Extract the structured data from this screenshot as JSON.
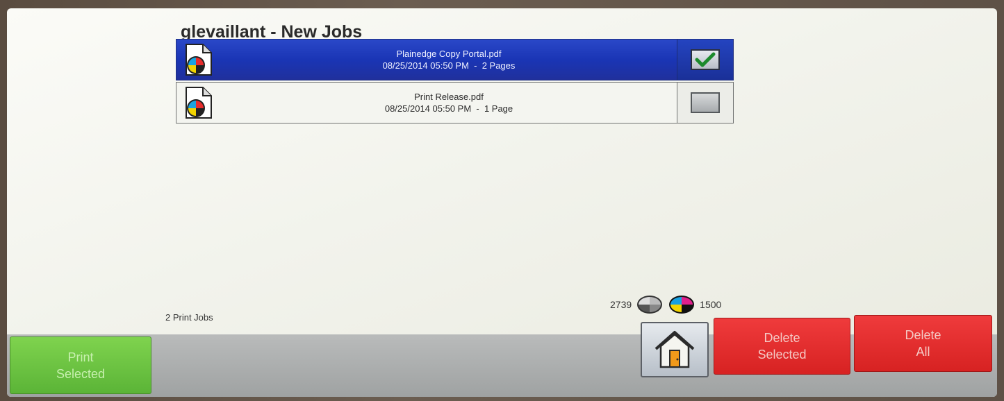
{
  "header": {
    "title": "glevaillant - New Jobs"
  },
  "jobs": [
    {
      "name": "Plainedge Copy Portal.pdf",
      "details": "08/25/2014 05:50 PM  -  2 Pages",
      "selected": true
    },
    {
      "name": "Print Release.pdf",
      "details": "08/25/2014 05:50 PM  -  1 Page",
      "selected": false
    }
  ],
  "status": {
    "job_count": "2 Print Jobs",
    "black_toner": "2739",
    "color_toner": "1500"
  },
  "buttons": {
    "print_selected_line1": "Print",
    "print_selected_line2": "Selected",
    "delete_selected_line1": "Delete",
    "delete_selected_line2": "Selected",
    "delete_all_line1": "Delete",
    "delete_all_line2": "All"
  },
  "icons": {
    "job": "color-pdf-document-icon",
    "checkbox": "checkmark-icon",
    "home": "home-icon",
    "mono": "grayscale-toner-icon",
    "color": "cmyk-toner-icon"
  },
  "colors": {
    "selected_row": "#1a35b5",
    "print_button": "#6bc341",
    "delete_button": "#e12d2d"
  }
}
